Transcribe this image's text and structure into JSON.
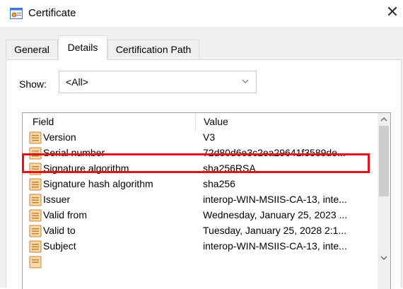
{
  "window": {
    "title": "Certificate"
  },
  "tabs": [
    "General",
    "Details",
    "Certification Path"
  ],
  "show": {
    "label": "Show:",
    "value": "<All>"
  },
  "list": {
    "headers": {
      "field": "Field",
      "value": "Value"
    },
    "rows": [
      {
        "field": "Version",
        "value": "V3"
      },
      {
        "field": "Serial number",
        "value": "72d80d6e3c2ea29641f3589de..."
      },
      {
        "field": "Signature algorithm",
        "value": "sha256RSA"
      },
      {
        "field": "Signature hash algorithm",
        "value": "sha256"
      },
      {
        "field": "Issuer",
        "value": "interop-WIN-MSIIS-CA-13, inte..."
      },
      {
        "field": "Valid from",
        "value": "Wednesday, January 25, 2023 ..."
      },
      {
        "field": "Valid to",
        "value": "Tuesday, January 25, 2028 2:1..."
      },
      {
        "field": "Subject",
        "value": "interop-WIN-MSIIS-CA-13, inte..."
      }
    ]
  },
  "colors": {
    "highlight": "#e0131d",
    "selected_tab_bg": "#ffffff",
    "client_bg": "#f0f0f0"
  }
}
